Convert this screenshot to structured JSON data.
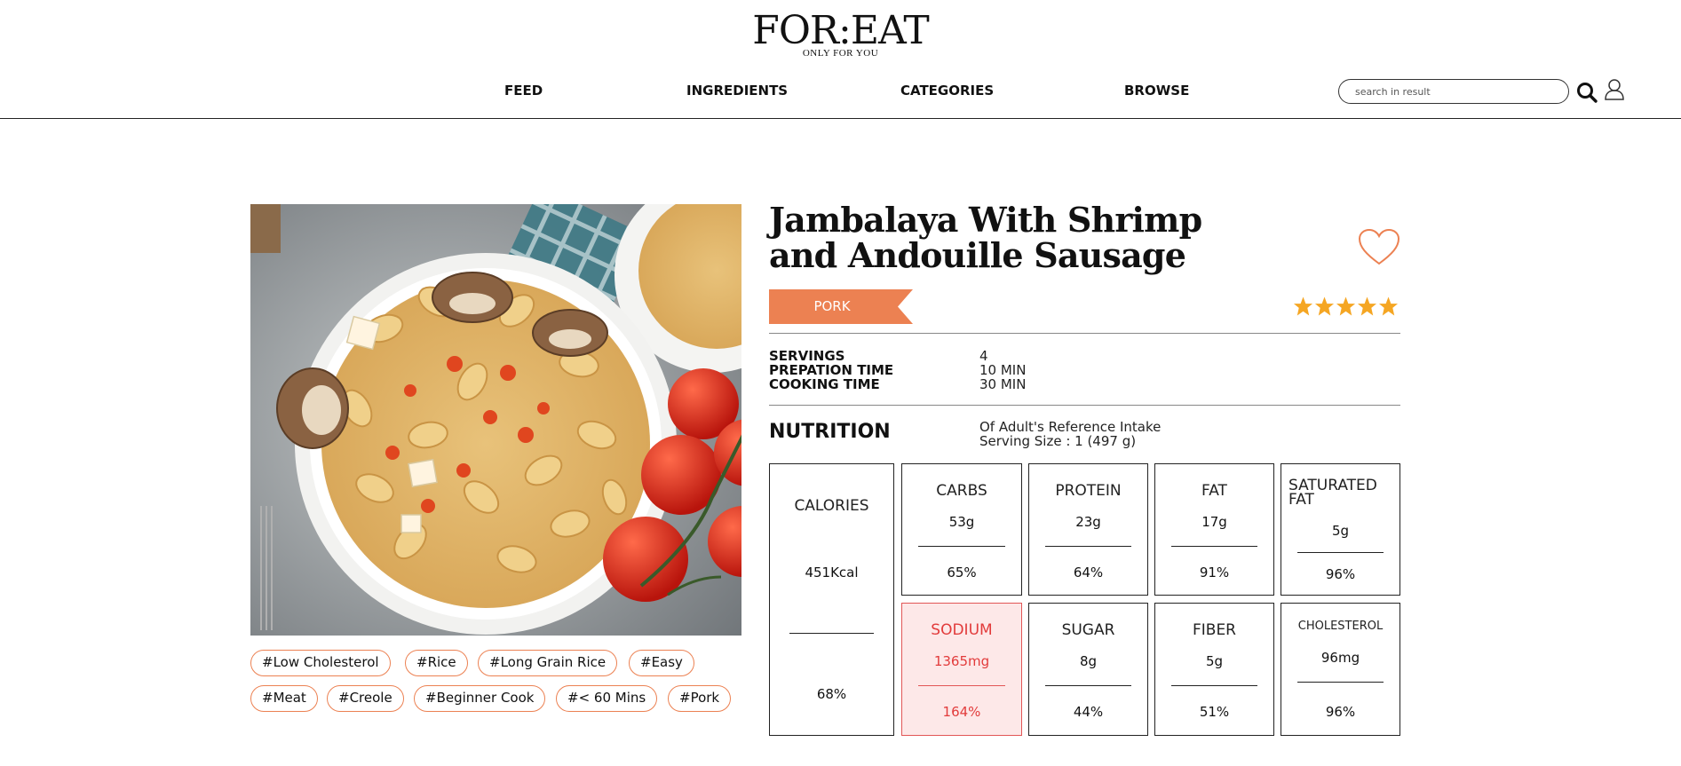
{
  "header": {
    "logo": "FOR:EAT",
    "tagline": "ONLY FOR YOU",
    "nav": [
      "FEED",
      "INGREDIENTS",
      "CATEGORIES",
      "BROWSE"
    ],
    "search_placeholder": "search in result",
    "icons": {
      "search": "search-icon",
      "user": "user-icon"
    }
  },
  "recipe": {
    "title": "Jambalaya With Shrimp and Andouille Sausage",
    "category": "PORK",
    "rating": 5,
    "rating_max": 5,
    "favorite_icon": "heart-outline-icon",
    "info_labels": [
      "SERVINGS",
      "PREPATION TIME",
      "COOKING TIME"
    ],
    "info_values": [
      "4",
      "10 MIN",
      "30 MIN"
    ],
    "tags": [
      "#Low Cholesterol",
      "#Rice",
      "#Long Grain Rice",
      "#Easy",
      "#Meat",
      "#Creole",
      "#Beginner Cook",
      "#< 60 Mins",
      "#Pork"
    ]
  },
  "nutrition": {
    "heading": "NUTRITION",
    "subtitle_line1": "Of Adult's Reference Intake",
    "subtitle_line2": "Serving Size : 1 (497 g)",
    "calories": {
      "label": "CALORIES",
      "amount": "451Kcal",
      "percent": "68%"
    },
    "items": [
      {
        "label": "CARBS",
        "amount": "53g",
        "percent": "65%"
      },
      {
        "label": "PROTEIN",
        "amount": "23g",
        "percent": "64%"
      },
      {
        "label": "FAT",
        "amount": "17g",
        "percent": "91%"
      },
      {
        "label": "SATURATED FAT",
        "amount": "5g",
        "percent": "96%"
      },
      {
        "label": "SODIUM",
        "amount": "1365mg",
        "percent": "164%",
        "highlight": true
      },
      {
        "label": "SUGAR",
        "amount": "8g",
        "percent": "44%"
      },
      {
        "label": "FIBER",
        "amount": "5g",
        "percent": "51%"
      },
      {
        "label": "CHOLESTEROL",
        "amount": "96mg",
        "percent": "96%"
      }
    ]
  },
  "colors": {
    "accent": "#ec8152",
    "star": "#f5a623",
    "warning": "#e23b3b",
    "warning_bg": "#fde8e8"
  }
}
